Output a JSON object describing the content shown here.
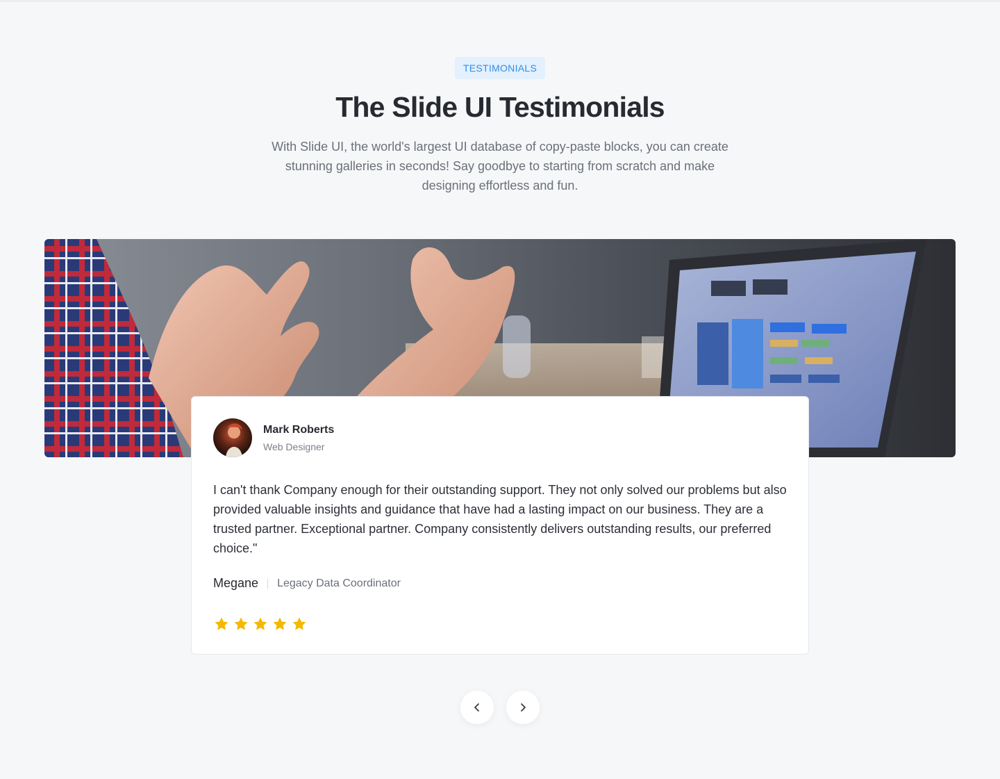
{
  "header": {
    "badge": "TESTIMONIALS",
    "title": "The Slide UI Testimonials",
    "subtitle": "With Slide UI, the world's largest UI database of copy-paste blocks, you can create stunning galleries in seconds! Say goodbye to starting from scratch and make designing effortless and fun."
  },
  "banner": {
    "image": "meeting-hands-laptop-photo"
  },
  "testimonial": {
    "author_name": "Mark Roberts",
    "author_role": "Web Designer",
    "avatar": "avatar-photo",
    "quote": "I can't thank Company enough for their outstanding support. They not only solved our problems but also provided valuable insights and guidance that have had a lasting impact on our business. They are a trusted partner. Exceptional partner. Company consistently delivers outstanding results, our preferred choice.\"",
    "reviewer_name": "Megane",
    "reviewer_title": "Legacy Data Coordinator",
    "rating": 5,
    "rating_max": 5
  },
  "navigation": {
    "prev_icon": "chevron-left-icon",
    "next_icon": "chevron-right-icon"
  },
  "colors": {
    "background": "#f6f7f9",
    "badge_bg": "#e4f0fd",
    "badge_text": "#2f8ee8",
    "star": "#f5b800"
  }
}
